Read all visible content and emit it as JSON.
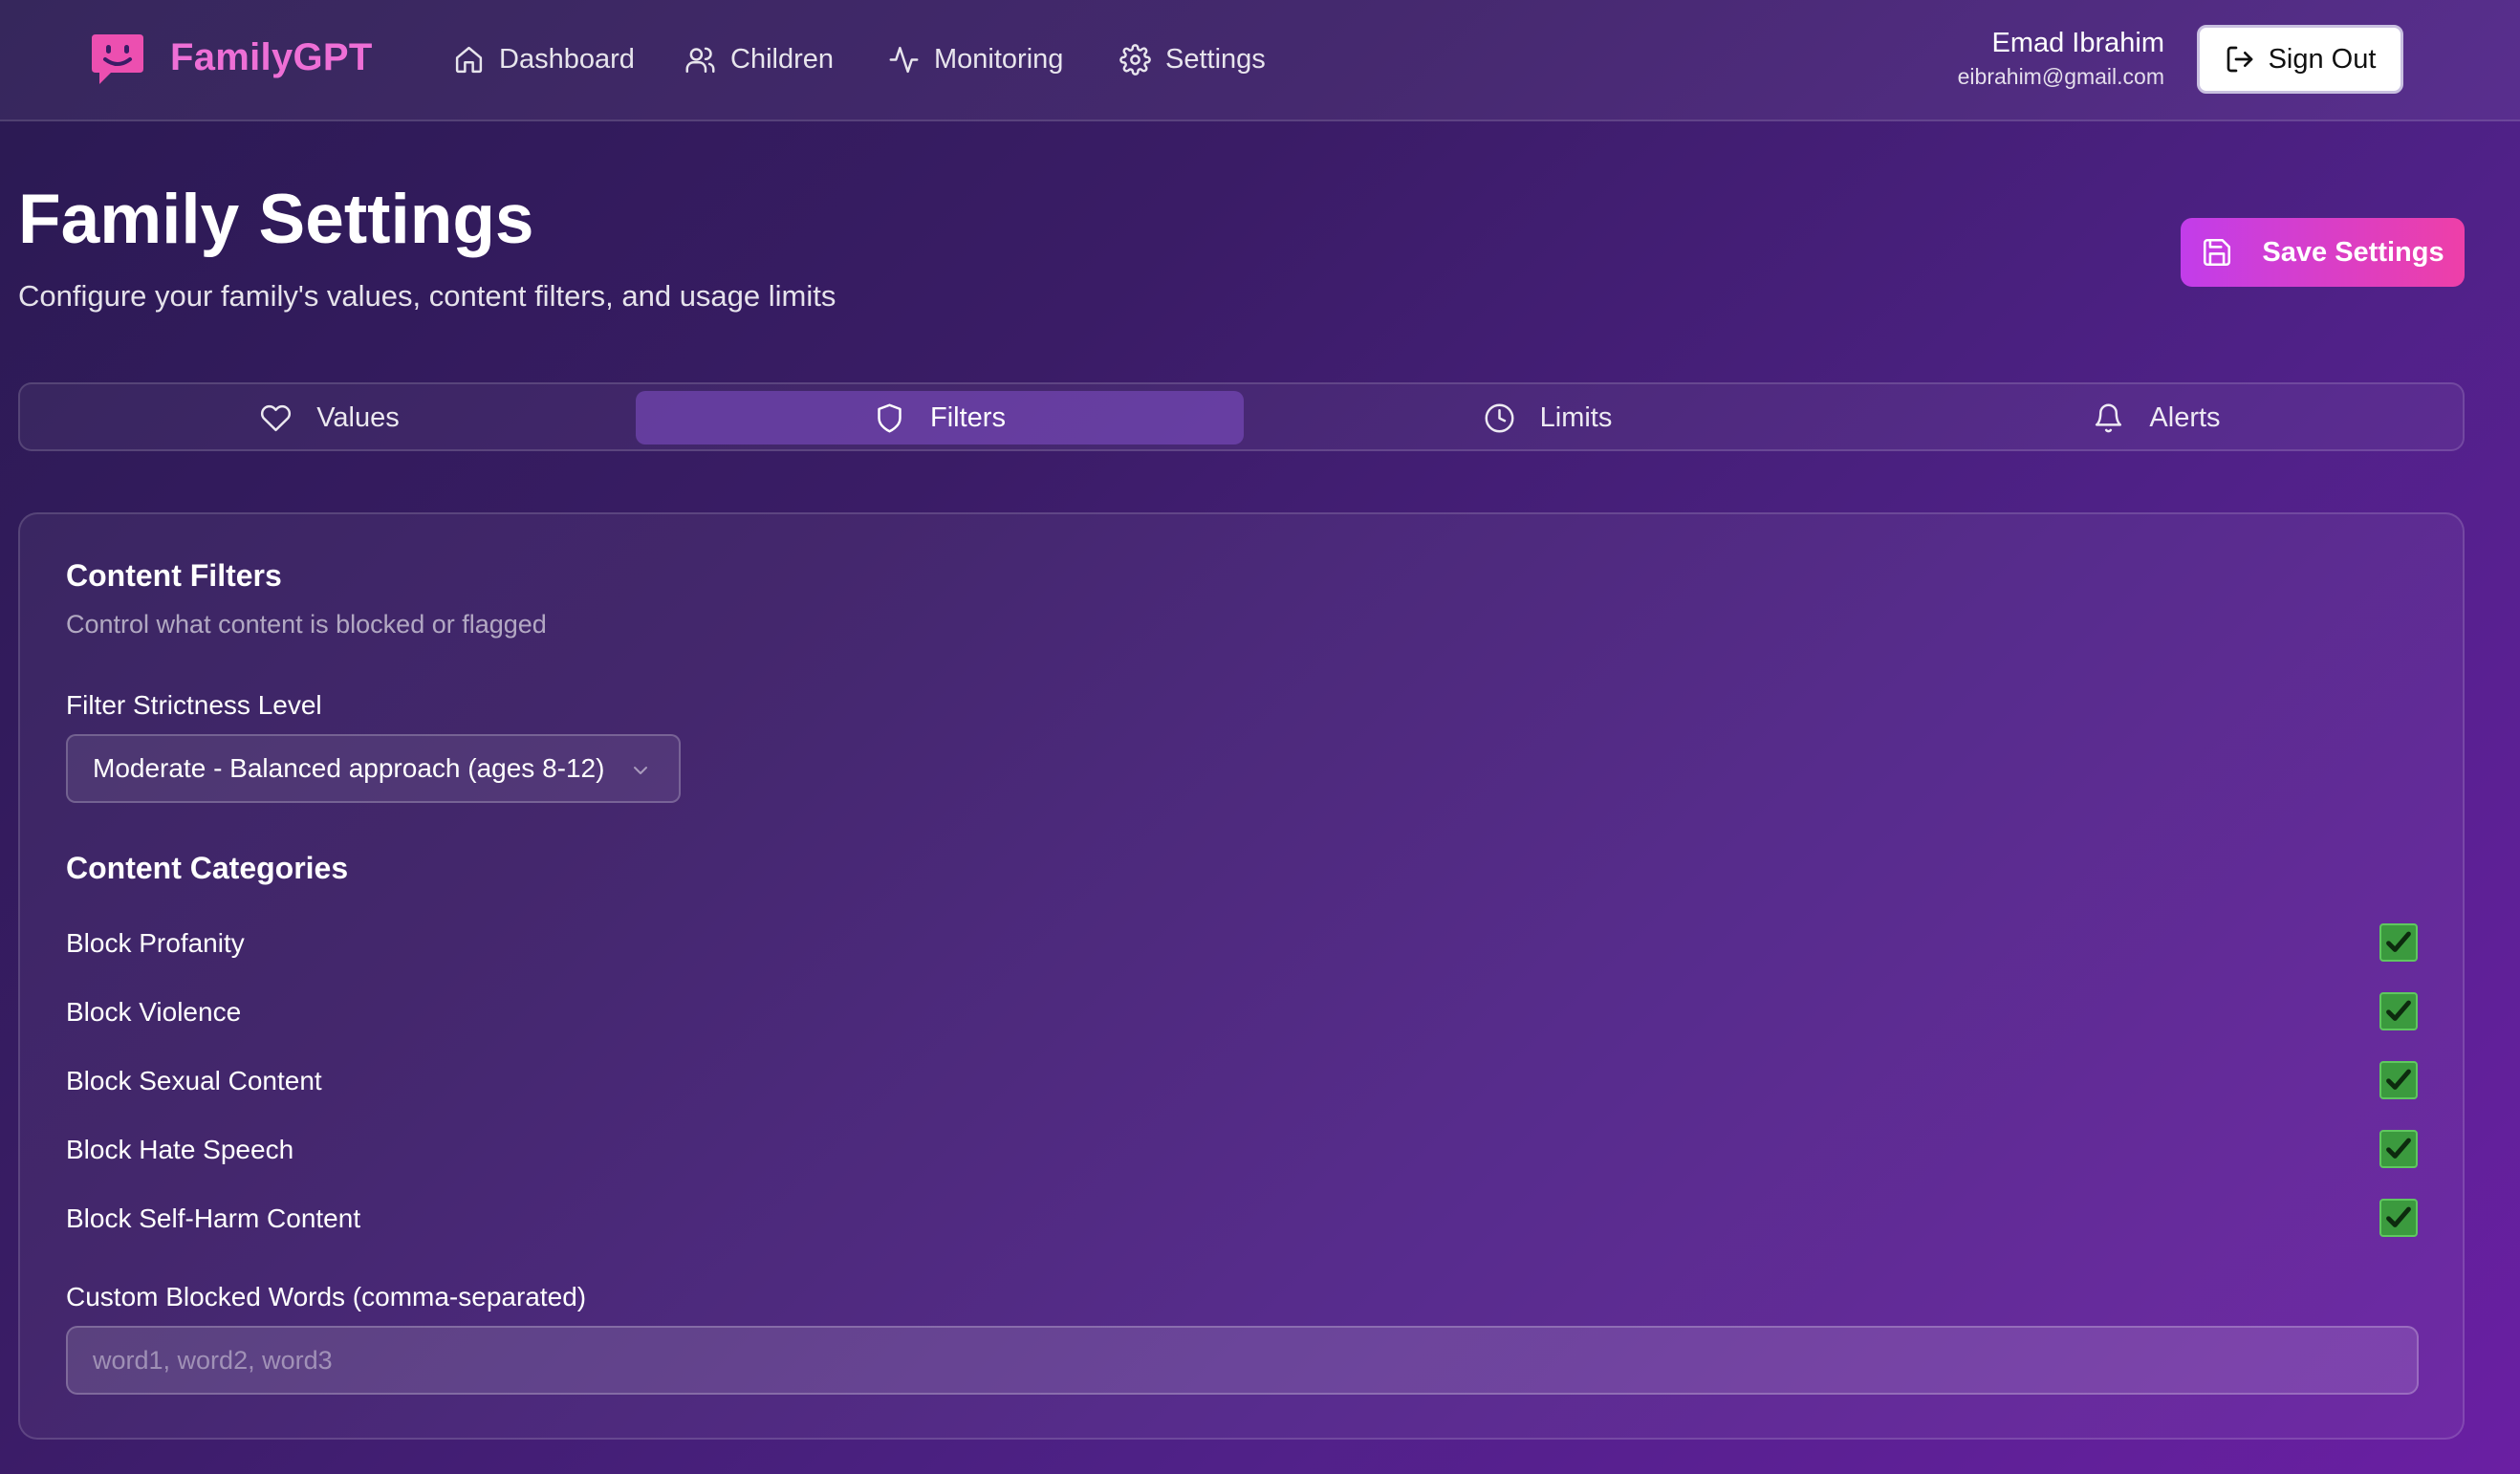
{
  "brand": {
    "name": "FamilyGPT",
    "accent": "#ee6fd6"
  },
  "nav": [
    {
      "label": "Dashboard",
      "icon": "home-icon"
    },
    {
      "label": "Children",
      "icon": "users-icon"
    },
    {
      "label": "Monitoring",
      "icon": "activity-icon"
    },
    {
      "label": "Settings",
      "icon": "gear-icon"
    }
  ],
  "user": {
    "name": "Emad Ibrahim",
    "email": "eibrahim@gmail.com",
    "signout_label": "Sign Out"
  },
  "header": {
    "title": "Family Settings",
    "subtitle": "Configure your family's values, content filters, and usage limits",
    "save_label": "Save Settings"
  },
  "tabs": [
    {
      "label": "Values",
      "icon": "heart-icon",
      "active": false
    },
    {
      "label": "Filters",
      "icon": "shield-icon",
      "active": true
    },
    {
      "label": "Limits",
      "icon": "clock-icon",
      "active": false
    },
    {
      "label": "Alerts",
      "icon": "bell-icon",
      "active": false
    }
  ],
  "card": {
    "title": "Content Filters",
    "description": "Control what content is blocked or flagged",
    "strictness_label": "Filter Strictness Level",
    "strictness_value": "Moderate - Balanced approach (ages 8-12)",
    "categories_title": "Content Categories",
    "categories": [
      {
        "label": "Block Profanity",
        "checked": true
      },
      {
        "label": "Block Violence",
        "checked": true
      },
      {
        "label": "Block Sexual Content",
        "checked": true
      },
      {
        "label": "Block Hate Speech",
        "checked": true
      },
      {
        "label": "Block Self-Harm Content",
        "checked": true
      }
    ],
    "custom_words_label": "Custom Blocked Words (comma-separated)",
    "custom_words_value": "",
    "custom_words_placeholder": "word1, word2, word3"
  },
  "colors": {
    "checkbox": "#3b9a3e",
    "save_gradient_start": "#c23dea",
    "save_gradient_end": "#ee3fa8"
  }
}
